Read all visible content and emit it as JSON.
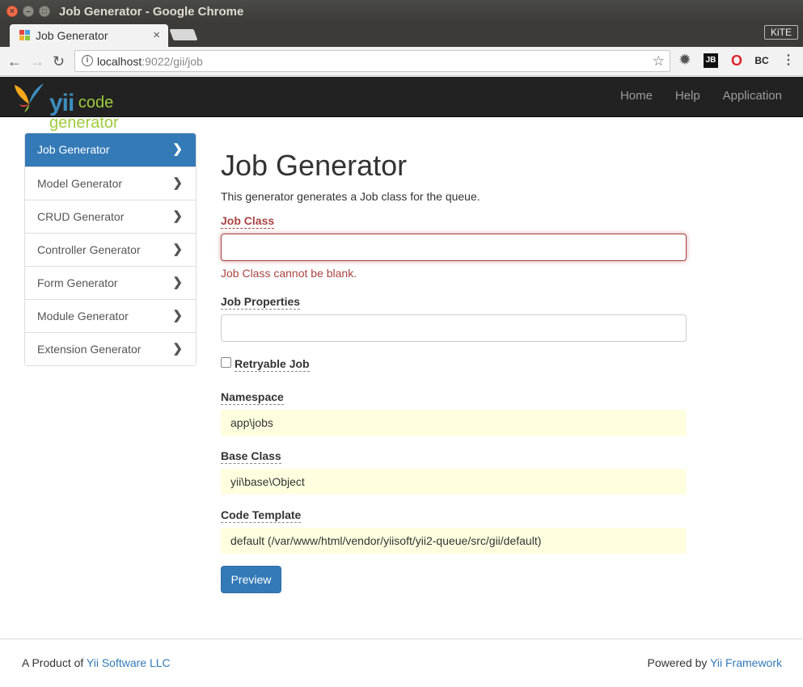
{
  "window": {
    "title": "Job Generator - Google Chrome",
    "tab_title": "Job Generator",
    "tab_close": "×",
    "kite_label": "KiTE"
  },
  "toolbar": {
    "url_host": "localhost",
    "url_rest": ":9022/gii/job",
    "ext_jb": "JB",
    "ext_bc": "BC"
  },
  "navbar": {
    "logo_yii": "yii",
    "logo_text": "code generator",
    "links": [
      "Home",
      "Help",
      "Application"
    ]
  },
  "sidebar": {
    "items": [
      {
        "label": "Job Generator",
        "active": true
      },
      {
        "label": "Model Generator",
        "active": false
      },
      {
        "label": "CRUD Generator",
        "active": false
      },
      {
        "label": "Controller Generator",
        "active": false
      },
      {
        "label": "Form Generator",
        "active": false
      },
      {
        "label": "Module Generator",
        "active": false
      },
      {
        "label": "Extension Generator",
        "active": false
      }
    ]
  },
  "main": {
    "heading": "Job Generator",
    "lead": "This generator generates a Job class for the queue.",
    "job_class": {
      "label": "Job Class",
      "value": "",
      "error": "Job Class cannot be blank."
    },
    "job_properties": {
      "label": "Job Properties",
      "value": ""
    },
    "retryable": {
      "label": "Retryable Job",
      "checked": false
    },
    "namespace": {
      "label": "Namespace",
      "value": "app\\jobs"
    },
    "base_class": {
      "label": "Base Class",
      "value": "yii\\base\\Object"
    },
    "code_template": {
      "label": "Code Template",
      "value": "default (/var/www/html/vendor/yiisoft/yii2-queue/src/gii/default)"
    },
    "preview_button": "Preview"
  },
  "footer": {
    "left_prefix": "A Product of ",
    "left_link": "Yii Software LLC",
    "right_prefix": "Powered by ",
    "right_link": "Yii Framework"
  },
  "colors": {
    "primary": "#337ab7",
    "error": "#a94442",
    "readonly_bg": "#ffffe0",
    "navbar_bg": "#222222"
  }
}
